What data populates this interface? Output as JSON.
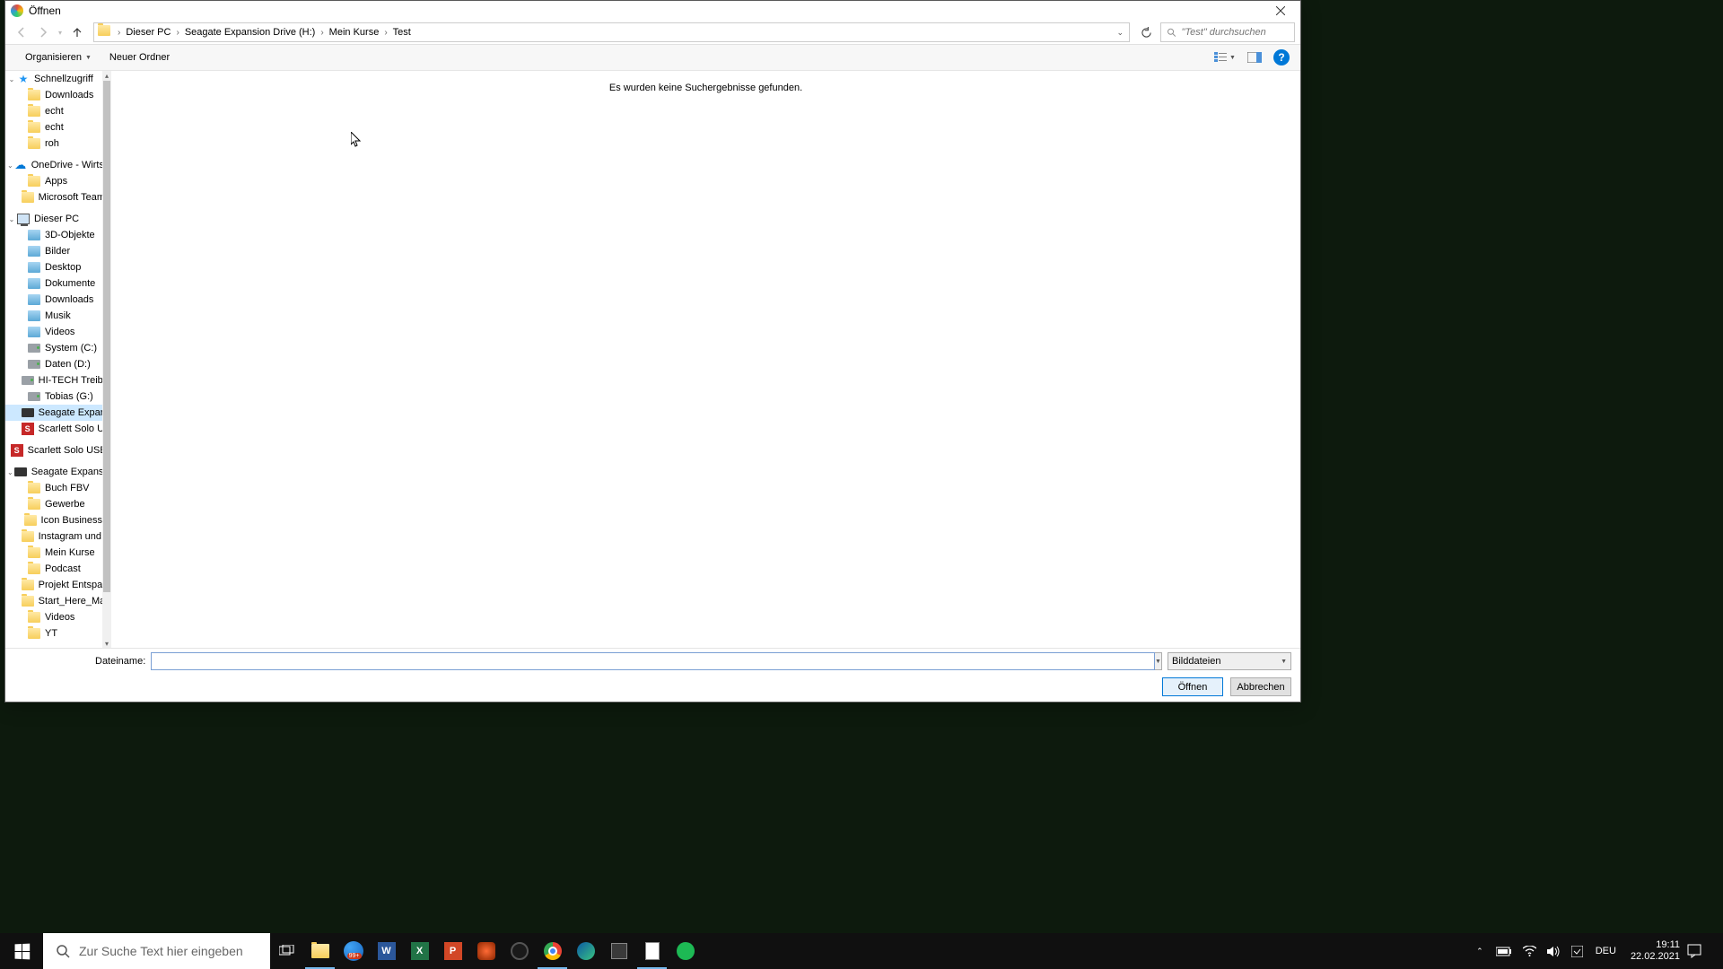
{
  "window": {
    "title": "Öffnen"
  },
  "nav": {
    "breadcrumb": [
      "Dieser PC",
      "Seagate Expansion Drive (H:)",
      "Mein Kurse",
      "Test"
    ],
    "search_placeholder": "\"Test\" durchsuchen"
  },
  "toolbar": {
    "organize": "Organisieren",
    "new_folder": "Neuer Ordner"
  },
  "tree": [
    {
      "type": "quick",
      "label": "Schnellzugriff",
      "indent": 1,
      "expanded": true
    },
    {
      "type": "folder",
      "label": "Downloads",
      "indent": 2
    },
    {
      "type": "folder",
      "label": "echt",
      "indent": 2
    },
    {
      "type": "folder",
      "label": "echt",
      "indent": 2
    },
    {
      "type": "folder",
      "label": "roh",
      "indent": 2
    },
    {
      "type": "spacer"
    },
    {
      "type": "cloud",
      "label": "OneDrive - Wirtsc",
      "indent": 1,
      "expanded": true
    },
    {
      "type": "folder",
      "label": "Apps",
      "indent": 2
    },
    {
      "type": "folder",
      "label": "Microsoft Teams",
      "indent": 2
    },
    {
      "type": "spacer"
    },
    {
      "type": "pc",
      "label": "Dieser PC",
      "indent": 1,
      "expanded": true
    },
    {
      "type": "lib",
      "label": "3D-Objekte",
      "indent": 2
    },
    {
      "type": "lib",
      "label": "Bilder",
      "indent": 2
    },
    {
      "type": "lib",
      "label": "Desktop",
      "indent": 2
    },
    {
      "type": "lib",
      "label": "Dokumente",
      "indent": 2
    },
    {
      "type": "lib",
      "label": "Downloads",
      "indent": 2
    },
    {
      "type": "lib",
      "label": "Musik",
      "indent": 2
    },
    {
      "type": "lib",
      "label": "Videos",
      "indent": 2
    },
    {
      "type": "drive",
      "label": "System (C:)",
      "indent": 2
    },
    {
      "type": "drive",
      "label": "Daten (D:)",
      "indent": 2
    },
    {
      "type": "drive",
      "label": "HI-TECH Treiber",
      "indent": 2
    },
    {
      "type": "drive",
      "label": "Tobias (G:)",
      "indent": 2
    },
    {
      "type": "dark",
      "label": "Seagate Expansi",
      "indent": 2,
      "active": true
    },
    {
      "type": "red",
      "label": "Scarlett Solo USB",
      "indent": 2
    },
    {
      "type": "spacer"
    },
    {
      "type": "red",
      "label": "Scarlett Solo USB ",
      "indent": 1
    },
    {
      "type": "spacer"
    },
    {
      "type": "dark",
      "label": "Seagate Expansion",
      "indent": 1,
      "expanded": true
    },
    {
      "type": "folder",
      "label": "Buch FBV",
      "indent": 2
    },
    {
      "type": "folder",
      "label": "Gewerbe",
      "indent": 2
    },
    {
      "type": "folder",
      "label": "Icon Business",
      "indent": 2
    },
    {
      "type": "folder",
      "label": "Instagram und T",
      "indent": 2
    },
    {
      "type": "folder",
      "label": "Mein Kurse",
      "indent": 2
    },
    {
      "type": "folder",
      "label": "Podcast",
      "indent": 2
    },
    {
      "type": "folder",
      "label": "Projekt Entspann",
      "indent": 2
    },
    {
      "type": "folder",
      "label": "Start_Here_Mac.",
      "indent": 2
    },
    {
      "type": "folder",
      "label": "Videos",
      "indent": 2
    },
    {
      "type": "folder",
      "label": "YT",
      "indent": 2
    }
  ],
  "content": {
    "no_results": "Es wurden keine Suchergebnisse gefunden."
  },
  "bottom": {
    "filename_label": "Dateiname:",
    "filename_value": "",
    "filetype": "Bilddateien",
    "open": "Öffnen",
    "cancel": "Abbrechen"
  },
  "taskbar": {
    "search_placeholder": "Zur Suche Text hier eingeben",
    "lang": "DEU",
    "time": "19:11",
    "date": "22.02.2021",
    "badge": "99+"
  }
}
